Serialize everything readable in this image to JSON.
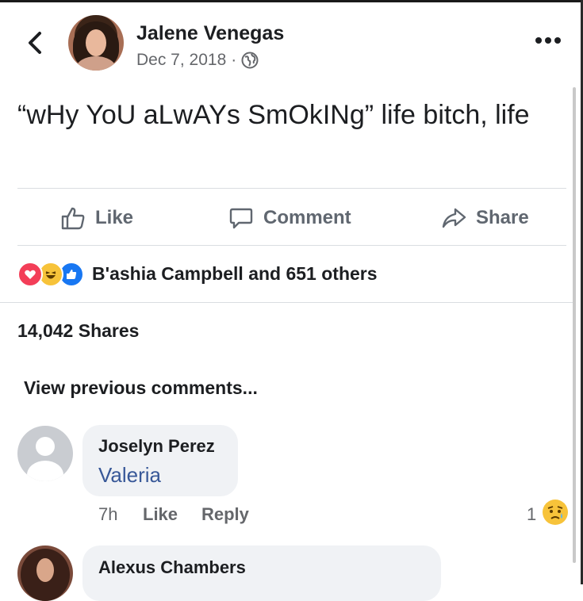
{
  "post": {
    "author": "Jalene Venegas",
    "date": "Dec 7, 2018",
    "separator": "·",
    "privacy_icon": "globe-icon",
    "text": "“wHy YoU aLwAYs SmOkINg” life bitch, life"
  },
  "actions": {
    "like": "Like",
    "comment": "Comment",
    "share": "Share"
  },
  "reactions": {
    "icons": [
      "love-icon",
      "haha-icon",
      "like-icon"
    ],
    "summary": "B'ashia Campbell and 651 others"
  },
  "shares": "14,042 Shares",
  "view_previous": "View previous comments...",
  "comments": [
    {
      "author": "Joselyn Perez",
      "text": "Valeria",
      "time": "7h",
      "like": "Like",
      "reply": "Reply",
      "reaction_count": "1",
      "reaction_icon": "sad-icon"
    },
    {
      "author": "Alexus Chambers"
    }
  ],
  "colors": {
    "text": "#1c1e21",
    "muted": "#65676b",
    "link": "#385898",
    "bubble": "#f0f2f5",
    "love": "#f33e58",
    "haha": "#f7c33a",
    "like": "#1877f2"
  }
}
